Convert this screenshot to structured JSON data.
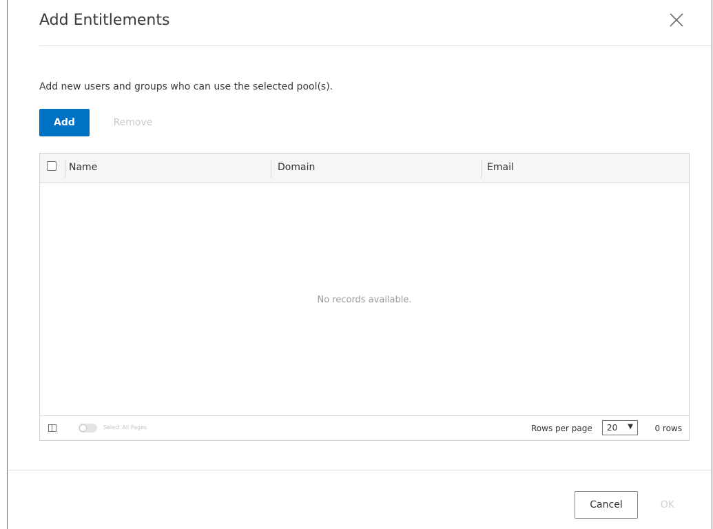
{
  "dialog": {
    "title": "Add Entitlements",
    "description": "Add new users and groups who can use the selected pool(s)."
  },
  "toolbar": {
    "add_label": "Add",
    "remove_label": "Remove"
  },
  "grid": {
    "columns": [
      "Name",
      "Domain",
      "Email"
    ],
    "rows": [],
    "empty_message": "No records available.",
    "footer": {
      "select_all_pages_label": "Select All Pages",
      "select_all_pages_enabled": false,
      "rows_per_page_label": "Rows per page",
      "rows_per_page_value": "20",
      "row_count": "0 rows"
    }
  },
  "footer": {
    "cancel_label": "Cancel",
    "ok_label": "OK"
  },
  "colors": {
    "primary": "#0072c6",
    "disabled_text": "#c8c8c8"
  },
  "icons": {
    "close": "close-icon",
    "column_toggle": "column-toggle-icon",
    "dropdown": "chevron-down-icon"
  }
}
